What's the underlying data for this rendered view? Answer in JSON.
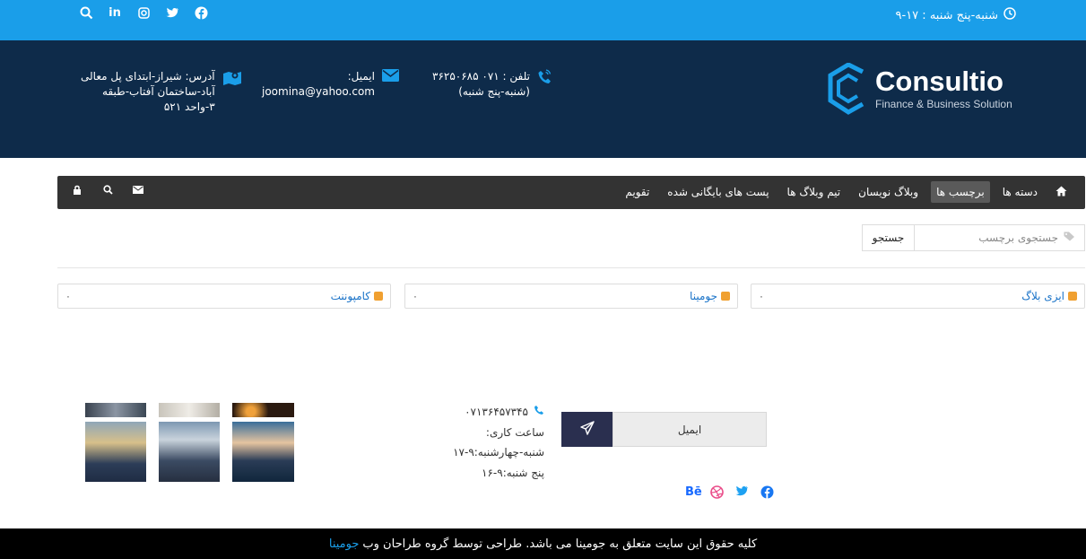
{
  "topbar": {
    "hours": "شنبه-پنج شنبه : ۱۷-۹",
    "social": [
      "search-icon",
      "linkedin-icon",
      "instagram-icon",
      "twitter-icon",
      "facebook-icon"
    ]
  },
  "header": {
    "brand": "Consultio",
    "tagline": "Finance & Business Solution",
    "phone_line1": "تلفن : ۰۷۱ ۳۶۲۵۰۶۸۵",
    "phone_line2": "(شنبه-پنج شنبه)",
    "email_label": "ایمیل:",
    "email_value": "joomina@yahoo.com",
    "address_line1": "آدرس: شیراز-ابتدای پل معالی",
    "address_line2": "آباد-ساختمان آفتاب-طبقه",
    "address_line3": "۳-واحد ۵۲۱"
  },
  "nav": {
    "items": [
      {
        "label": "دسته ها"
      },
      {
        "label": "برچسب ها",
        "active": true
      },
      {
        "label": "وبلاگ نویسان"
      },
      {
        "label": "تیم وبلاگ ها"
      },
      {
        "label": "پست های بایگانی شده"
      },
      {
        "label": "تقویم"
      }
    ]
  },
  "search": {
    "placeholder": "جستجوی برچسب",
    "button": "جستجو"
  },
  "tags": [
    {
      "name": "ایزی بلاگ",
      "count": "۰"
    },
    {
      "name": "جومینا",
      "count": "۰"
    },
    {
      "name": "کامپوننت",
      "count": "۰"
    }
  ],
  "footer": {
    "phone": "۰۷۱۳۶۴۵۷۳۴۵",
    "hours_label": "ساعت کاری:",
    "hours_1": "شنبه-چهارشنبه:۹-۱۷",
    "hours_2": "پنج شنبه:۹-۱۶",
    "email_placeholder": "ایمیل",
    "copyright": "کلیه حقوق این سایت متعلق به جومینا می باشد. طراحی توسط گروه طراحان وب",
    "copyright_link": "جومینا"
  },
  "colors": {
    "topbar": "#1a9ee9",
    "header": "#0e2b4a",
    "navbar": "#333333",
    "link": "#1a73c8"
  }
}
